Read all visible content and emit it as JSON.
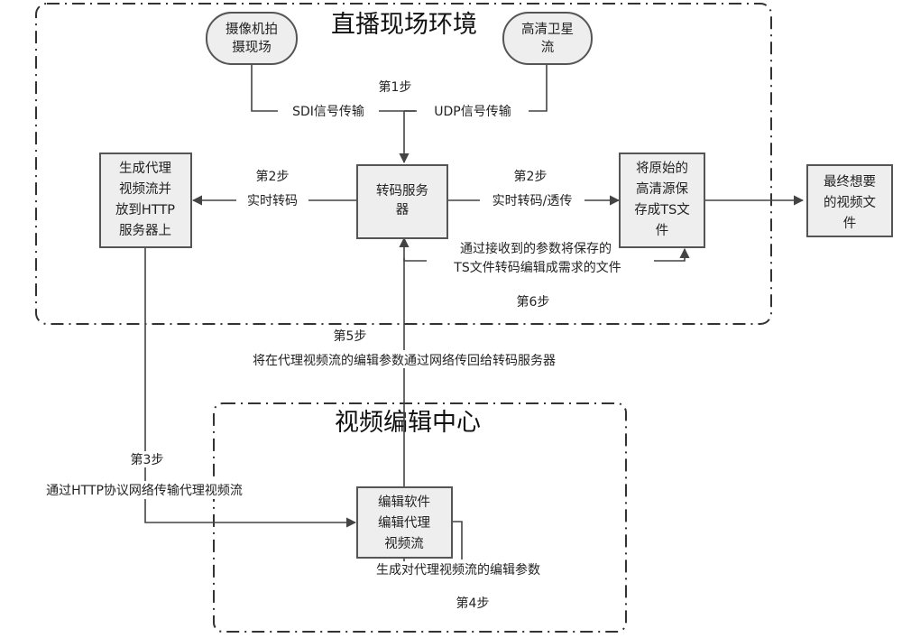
{
  "regions": {
    "live_site": {
      "title": "直播现场环境"
    },
    "edit_center": {
      "title": "视频编辑中心"
    }
  },
  "nodes": {
    "camera": {
      "lines": [
        "摄像机拍",
        "摄现场"
      ]
    },
    "satellite": {
      "lines": [
        "高清卫星",
        "流"
      ]
    },
    "transcoder": {
      "lines": [
        "转码服务",
        "器"
      ]
    },
    "proxy": {
      "lines": [
        "生成代理",
        "视频流并",
        "放到HTTP",
        "服务器上"
      ]
    },
    "ts_saver": {
      "lines": [
        "将原始的",
        "高清源保",
        "存成TS文",
        "件"
      ]
    },
    "final_file": {
      "lines": [
        "最终想要",
        "的视频文",
        "件"
      ]
    },
    "editor": {
      "lines": [
        "编辑软件",
        "编辑代理",
        "视频流"
      ]
    }
  },
  "labels": {
    "step1": "第1步",
    "sdi": "SDI信号传输",
    "udp": "UDP信号传输",
    "step2_left": "第2步",
    "realtime_transcode": "实时转码",
    "step2_right": "第2步",
    "realtime_transcode_pass": "实时转码/透传",
    "step6_line1": "通过接收到的参数将保存的",
    "step6_line2": "TS文件转码编辑成需求的文件",
    "step6": "第6步",
    "step5": "第5步",
    "step5_desc": "将在代理视频流的编辑参数通过网络传回给转码服务器",
    "step3": "第3步",
    "step3_desc": "通过HTTP协议网络传输代理视频流",
    "step4_desc": "生成对代理视频流的编辑参数",
    "step4": "第4步"
  }
}
